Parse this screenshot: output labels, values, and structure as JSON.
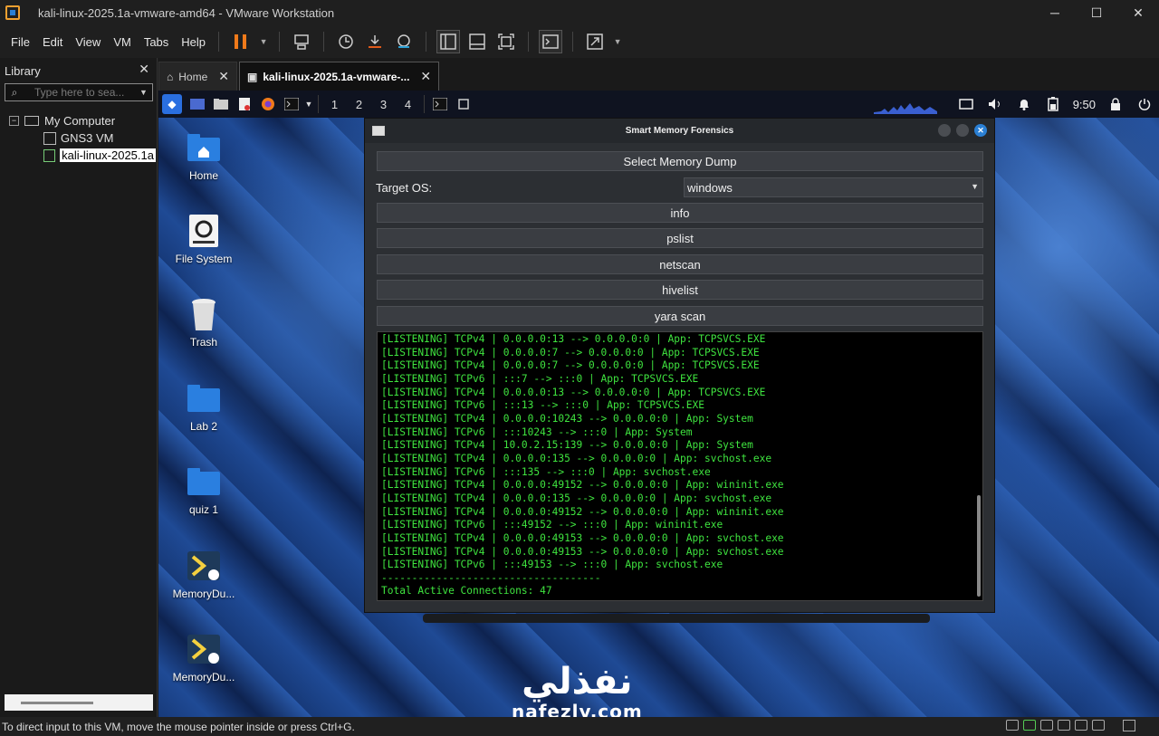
{
  "window": {
    "title": "kali-linux-2025.1a-vmware-amd64 - VMware Workstation",
    "controls": [
      "─",
      "☐",
      "✕"
    ]
  },
  "menu": [
    "File",
    "Edit",
    "View",
    "VM",
    "Tabs",
    "Help"
  ],
  "library": {
    "title": "Library",
    "close": "✕",
    "search_placeholder": "Type here to sea...",
    "tree": [
      {
        "label": "My Computer",
        "expander": "−"
      },
      {
        "label": "GNS3 VM"
      },
      {
        "label": "kali-linux-2025.1a"
      }
    ]
  },
  "tabs": [
    {
      "label": "Home",
      "icon": "⌂",
      "close": "✕"
    },
    {
      "label": "kali-linux-2025.1a-vmware-...",
      "icon": "▣",
      "close": "✕"
    }
  ],
  "vm_panel": {
    "workspaces": [
      "1",
      "2",
      "3",
      "4"
    ],
    "clock": "9:50"
  },
  "desktop_icons": [
    {
      "label": "Home"
    },
    {
      "label": "File System"
    },
    {
      "label": "Trash"
    },
    {
      "label": "Lab 2"
    },
    {
      "label": "quiz 1"
    },
    {
      "label": "MemoryDu..."
    },
    {
      "label": "MemoryDu..."
    }
  ],
  "app": {
    "title": "Smart Memory Forensics",
    "select_dump": "Select Memory Dump",
    "target_os_label": "Target OS:",
    "target_os_value": "windows",
    "buttons": [
      "info",
      "pslist",
      "netscan",
      "hivelist",
      "yara scan"
    ],
    "console_lines": [
      "[LISTENING] TCPv4 | 0.0.0.0:13 --> 0.0.0.0:0 | App: TCPSVCS.EXE",
      "[LISTENING] TCPv4 | 0.0.0.0:7 --> 0.0.0.0:0 | App: TCPSVCS.EXE",
      "[LISTENING] TCPv4 | 0.0.0.0:7 --> 0.0.0.0:0 | App: TCPSVCS.EXE",
      "[LISTENING] TCPv6 | :::7 --> :::0 | App: TCPSVCS.EXE",
      "[LISTENING] TCPv4 | 0.0.0.0:13 --> 0.0.0.0:0 | App: TCPSVCS.EXE",
      "[LISTENING] TCPv6 | :::13 --> :::0 | App: TCPSVCS.EXE",
      "[LISTENING] TCPv4 | 0.0.0.0:10243 --> 0.0.0.0:0 | App: System",
      "[LISTENING] TCPv6 | :::10243 --> :::0 | App: System",
      "[LISTENING] TCPv4 | 10.0.2.15:139 --> 0.0.0.0:0 | App: System",
      "[LISTENING] TCPv4 | 0.0.0.0:135 --> 0.0.0.0:0 | App: svchost.exe",
      "[LISTENING] TCPv6 | :::135 --> :::0 | App: svchost.exe",
      "[LISTENING] TCPv4 | 0.0.0.0:49152 --> 0.0.0.0:0 | App: wininit.exe",
      "[LISTENING] TCPv4 | 0.0.0.0:135 --> 0.0.0.0:0 | App: svchost.exe",
      "[LISTENING] TCPv4 | 0.0.0.0:49152 --> 0.0.0.0:0 | App: wininit.exe",
      "[LISTENING] TCPv6 | :::49152 --> :::0 | App: wininit.exe",
      "[LISTENING] TCPv4 | 0.0.0.0:49153 --> 0.0.0.0:0 | App: svchost.exe",
      "[LISTENING] TCPv4 | 0.0.0.0:49153 --> 0.0.0.0:0 | App: svchost.exe",
      "[LISTENING] TCPv6 | :::49153 --> :::0 | App: svchost.exe",
      "------------------------------------",
      "Total Active Connections: 47"
    ]
  },
  "watermark": {
    "arabic": "نفذلي",
    "latin": "nafezly.com"
  },
  "status_bar": "To direct input to this VM, move the mouse pointer inside or press Ctrl+G.",
  "colors": {
    "console_text": "#3fe43f",
    "accent": "#2a7fd4"
  }
}
